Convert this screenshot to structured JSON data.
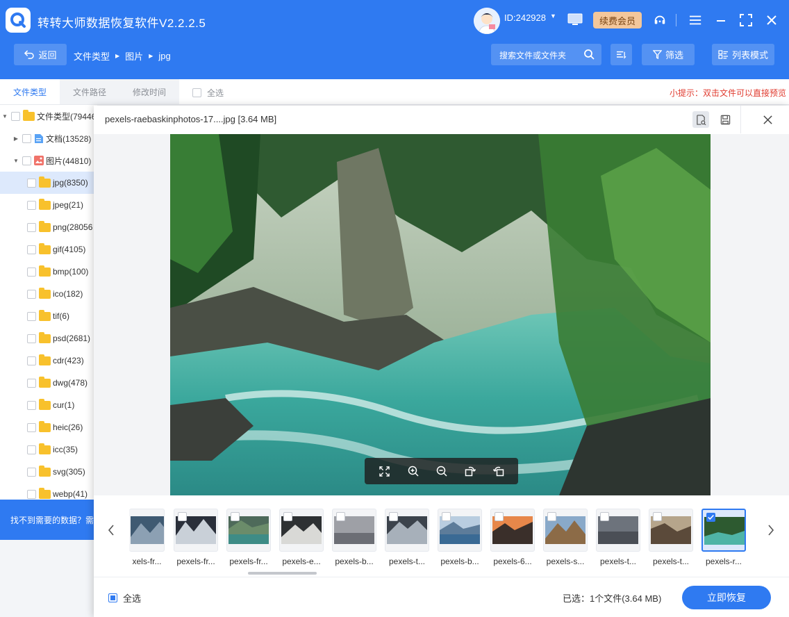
{
  "app": {
    "title": "转转大师数据恢复软件V2.2.2.5",
    "user_id": "ID:242928",
    "vip_label": "续费会员"
  },
  "toolbar": {
    "back_label": "返回",
    "breadcrumbs": [
      "文件类型",
      "图片",
      "jpg"
    ],
    "search_placeholder": "搜索文件或文件夹",
    "filter_label": "筛选",
    "view_mode_label": "列表模式"
  },
  "tabs": {
    "items": [
      "文件类型",
      "文件路径",
      "修改时间"
    ],
    "select_all": "全选",
    "tip": "小提示：双击文件可以直接预览"
  },
  "tree": {
    "root": "文件类型(79446",
    "docs": "文档(13528)",
    "images": "图片(44810)",
    "items": [
      "jpg(8350)",
      "jpeg(21)",
      "png(28056",
      "gif(4105)",
      "bmp(100)",
      "ico(182)",
      "tif(6)",
      "psd(2681)",
      "cdr(423)",
      "dwg(478)",
      "cur(1)",
      "heic(26)",
      "icc(35)",
      "svg(305)",
      "webp(41)"
    ],
    "banner": "找不到需要的数据？需"
  },
  "preview": {
    "title": "pexels-raebaskinphotos-17....jpg [3.64 MB]",
    "thumbnails": [
      "xels-fr...",
      "pexels-fr...",
      "pexels-fr...",
      "pexels-e...",
      "pexels-b...",
      "pexels-t...",
      "pexels-b...",
      "pexels-6...",
      "pexels-s...",
      "pexels-t...",
      "pexels-t...",
      "pexels-r..."
    ],
    "selected_thumbnail_index": 11
  },
  "footer": {
    "select_all": "全选",
    "selected_info": "已选：1个文件(3.64 MB)",
    "recover_label": "立即恢复"
  },
  "colors": {
    "primary": "#2f7af1",
    "vip": "#f3c79b",
    "tip": "#e03b2f",
    "folder": "#f8c12c"
  }
}
